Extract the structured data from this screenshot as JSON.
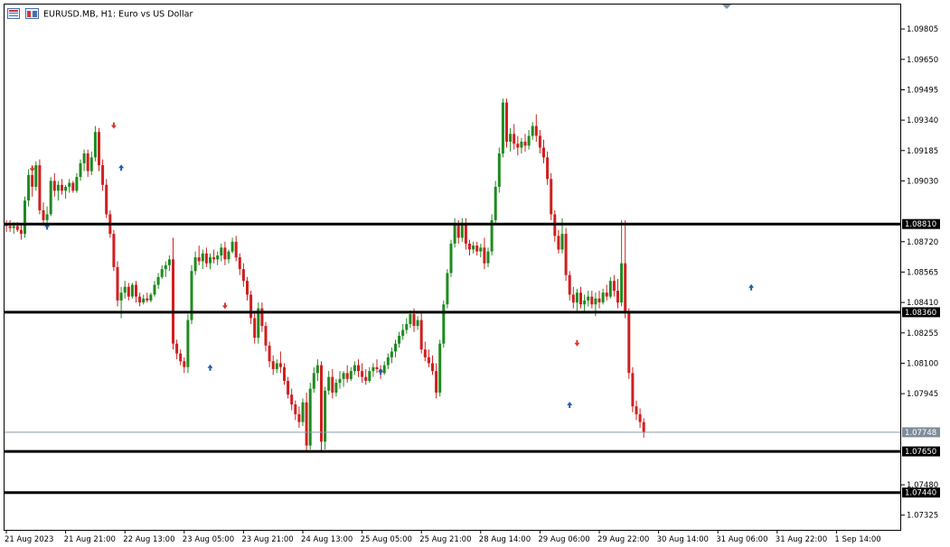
{
  "window": {
    "symbol": "EURUSD.MB",
    "timeframe": "H1",
    "description": "Euro vs US Dollar",
    "title_sep": ", ",
    "desc_sep": ": "
  },
  "colors": {
    "bull": "#1f8a1f",
    "bear": "#d01f1f",
    "doji": "#000000",
    "grid_frame": "#000000",
    "bid_line": "#8a9aa8",
    "bid_label_bg": "#7f8c99",
    "buy_arrow": "#1e5fb4",
    "sell_arrow": "#d9352b"
  },
  "chart_data": {
    "type": "candlestick",
    "ylim": [
      1.0725,
      1.0993
    ],
    "y_ticks": [
      "1.09805",
      "1.09650",
      "1.09495",
      "1.09340",
      "1.09185",
      "1.09030",
      "1.08720",
      "1.08565",
      "1.08410",
      "1.08255",
      "1.08100",
      "1.07945",
      "1.07480",
      "1.07325"
    ],
    "x_ticks": [
      "21 Aug 2023",
      "21 Aug 21:00",
      "22 Aug 13:00",
      "23 Aug 05:00",
      "23 Aug 21:00",
      "24 Aug 13:00",
      "25 Aug 05:00",
      "25 Aug 21:00",
      "28 Aug 14:00",
      "29 Aug 06:00",
      "29 Aug 22:00",
      "30 Aug 14:00",
      "31 Aug 06:00",
      "31 Aug 22:00",
      "1 Sep 14:00"
    ],
    "x_tick_bar_index": [
      0,
      16,
      32,
      48,
      64,
      80,
      96,
      112,
      128,
      144,
      160,
      176,
      192,
      208,
      224
    ],
    "bid": "1.07748",
    "horizontal_lines": [
      "1.08810",
      "1.08360",
      "1.07650",
      "1.07440"
    ],
    "ohlc": [
      [
        1.0881,
        1.0883,
        1.0877,
        1.088
      ],
      [
        1.088,
        1.0883,
        1.0877,
        1.0879
      ],
      [
        1.0879,
        1.0882,
        1.0876,
        1.088
      ],
      [
        1.088,
        1.0882,
        1.0877,
        1.0878
      ],
      [
        1.0878,
        1.0881,
        1.0873,
        1.0876
      ],
      [
        1.0876,
        1.0895,
        1.0874,
        1.0893
      ],
      [
        1.0893,
        1.0909,
        1.089,
        1.0906
      ],
      [
        1.0906,
        1.0908,
        1.0895,
        1.09
      ],
      [
        1.09,
        1.0913,
        1.0898,
        1.0911
      ],
      [
        1.0911,
        1.0914,
        1.0886,
        1.0888
      ],
      [
        1.0888,
        1.0892,
        1.088,
        1.0883
      ],
      [
        1.0883,
        1.089,
        1.088,
        1.0886
      ],
      [
        1.0886,
        1.0905,
        1.0885,
        1.0903
      ],
      [
        1.0903,
        1.0907,
        1.0895,
        1.0898
      ],
      [
        1.0898,
        1.0903,
        1.0893,
        1.0901
      ],
      [
        1.0901,
        1.0904,
        1.0896,
        1.0898
      ],
      [
        1.0898,
        1.0901,
        1.0894,
        1.09
      ],
      [
        1.09,
        1.0904,
        1.0897,
        1.0902
      ],
      [
        1.0902,
        1.0903,
        1.0897,
        1.0898
      ],
      [
        1.0898,
        1.0907,
        1.0897,
        1.0905
      ],
      [
        1.0905,
        1.0914,
        1.0903,
        1.0912
      ],
      [
        1.0912,
        1.0919,
        1.0908,
        1.0917
      ],
      [
        1.0917,
        1.0919,
        1.0905,
        1.0908
      ],
      [
        1.0908,
        1.0918,
        1.0906,
        1.0915
      ],
      [
        1.0915,
        1.0931,
        1.0913,
        1.0928
      ],
      [
        1.0928,
        1.093,
        1.0908,
        1.0911
      ],
      [
        1.0911,
        1.0914,
        1.0898,
        1.0901
      ],
      [
        1.0901,
        1.0904,
        1.0884,
        1.0886
      ],
      [
        1.0886,
        1.0888,
        1.0874,
        1.0876
      ],
      [
        1.0876,
        1.0878,
        1.0857,
        1.0859
      ],
      [
        1.0859,
        1.0862,
        1.0839,
        1.0842
      ],
      [
        1.0842,
        1.0849,
        1.0833,
        1.0846
      ],
      [
        1.0846,
        1.0852,
        1.0843,
        1.0849
      ],
      [
        1.0849,
        1.0851,
        1.0842,
        1.0844
      ],
      [
        1.0844,
        1.0851,
        1.0843,
        1.085
      ],
      [
        1.085,
        1.0852,
        1.0841,
        1.0844
      ],
      [
        1.0844,
        1.0846,
        1.0839,
        1.0841
      ],
      [
        1.0841,
        1.0845,
        1.084,
        1.0843
      ],
      [
        1.0843,
        1.0846,
        1.0841,
        1.0842
      ],
      [
        1.0842,
        1.0846,
        1.0841,
        1.0845
      ],
      [
        1.0845,
        1.0852,
        1.0844,
        1.085
      ],
      [
        1.085,
        1.0856,
        1.0848,
        1.0854
      ],
      [
        1.0854,
        1.086,
        1.0853,
        1.0858
      ],
      [
        1.0858,
        1.0862,
        1.0854,
        1.086
      ],
      [
        1.086,
        1.0865,
        1.0857,
        1.0863
      ],
      [
        1.0863,
        1.0874,
        1.0817,
        1.082
      ],
      [
        1.082,
        1.0822,
        1.0812,
        1.0815
      ],
      [
        1.0815,
        1.0817,
        1.0809,
        1.0811
      ],
      [
        1.0811,
        1.0813,
        1.0805,
        1.0808
      ],
      [
        1.0808,
        1.0835,
        1.0805,
        1.0832
      ],
      [
        1.0832,
        1.086,
        1.083,
        1.0857
      ],
      [
        1.0857,
        1.0867,
        1.0855,
        1.0864
      ],
      [
        1.0864,
        1.087,
        1.086,
        1.0862
      ],
      [
        1.0862,
        1.0868,
        1.0858,
        1.0866
      ],
      [
        1.0866,
        1.0869,
        1.0859,
        1.0861
      ],
      [
        1.0861,
        1.0866,
        1.0858,
        1.0864
      ],
      [
        1.0864,
        1.0868,
        1.0861,
        1.0863
      ],
      [
        1.0863,
        1.0867,
        1.086,
        1.0865
      ],
      [
        1.0865,
        1.0871,
        1.0862,
        1.0869
      ],
      [
        1.0869,
        1.0872,
        1.086,
        1.0863
      ],
      [
        1.0863,
        1.0868,
        1.0861,
        1.0867
      ],
      [
        1.0867,
        1.0874,
        1.0866,
        1.0872
      ],
      [
        1.0872,
        1.0875,
        1.0862,
        1.0864
      ],
      [
        1.0864,
        1.0866,
        1.0855,
        1.0858
      ],
      [
        1.0858,
        1.0861,
        1.0849,
        1.0852
      ],
      [
        1.0852,
        1.0854,
        1.0842,
        1.0845
      ],
      [
        1.0845,
        1.0847,
        1.083,
        1.0833
      ],
      [
        1.0833,
        1.0836,
        1.082,
        1.0823
      ],
      [
        1.0823,
        1.0841,
        1.082,
        1.0838
      ],
      [
        1.0838,
        1.0841,
        1.0826,
        1.0829
      ],
      [
        1.0829,
        1.0831,
        1.0816,
        1.0819
      ],
      [
        1.0819,
        1.0821,
        1.0808,
        1.0811
      ],
      [
        1.0811,
        1.0814,
        1.0804,
        1.0807
      ],
      [
        1.0807,
        1.0812,
        1.0805,
        1.081
      ],
      [
        1.081,
        1.0816,
        1.0805,
        1.0808
      ],
      [
        1.0808,
        1.081,
        1.0799,
        1.0801
      ],
      [
        1.0801,
        1.0803,
        1.0792,
        1.0794
      ],
      [
        1.0794,
        1.0797,
        1.0786,
        1.0789
      ],
      [
        1.0789,
        1.0791,
        1.0781,
        1.0784
      ],
      [
        1.0784,
        1.0788,
        1.0777,
        1.078
      ],
      [
        1.078,
        1.0792,
        1.0778,
        1.079
      ],
      [
        1.079,
        1.0795,
        1.0765,
        1.0768
      ],
      [
        1.0768,
        1.08,
        1.0766,
        1.0797
      ],
      [
        1.0797,
        1.0808,
        1.0795,
        1.0805
      ],
      [
        1.0805,
        1.0812,
        1.0801,
        1.0809
      ],
      [
        1.0809,
        1.0811,
        1.0765,
        1.077
      ],
      [
        1.077,
        1.0798,
        1.0766,
        1.0796
      ],
      [
        1.0796,
        1.0806,
        1.0794,
        1.0803
      ],
      [
        1.0803,
        1.0807,
        1.0792,
        1.0795
      ],
      [
        1.0795,
        1.0802,
        1.0793,
        1.08
      ],
      [
        1.08,
        1.0806,
        1.0797,
        1.0802
      ],
      [
        1.0802,
        1.0806,
        1.0798,
        1.0805
      ],
      [
        1.0805,
        1.0809,
        1.08,
        1.0802
      ],
      [
        1.0802,
        1.0808,
        1.0801,
        1.0806
      ],
      [
        1.0806,
        1.0811,
        1.0804,
        1.0809
      ],
      [
        1.0809,
        1.0812,
        1.0803,
        1.0806
      ],
      [
        1.0806,
        1.081,
        1.08,
        1.0803
      ],
      [
        1.0803,
        1.0807,
        1.0799,
        1.0801
      ],
      [
        1.0801,
        1.0808,
        1.08,
        1.0806
      ],
      [
        1.0806,
        1.081,
        1.0803,
        1.0808
      ],
      [
        1.0808,
        1.0812,
        1.0805,
        1.0807
      ],
      [
        1.0807,
        1.0809,
        1.0802,
        1.0805
      ],
      [
        1.0805,
        1.0811,
        1.0804,
        1.0809
      ],
      [
        1.0809,
        1.0815,
        1.0807,
        1.0813
      ],
      [
        1.0813,
        1.0818,
        1.081,
        1.0816
      ],
      [
        1.0816,
        1.0822,
        1.0813,
        1.082
      ],
      [
        1.082,
        1.0826,
        1.0818,
        1.0824
      ],
      [
        1.0824,
        1.083,
        1.0822,
        1.0827
      ],
      [
        1.0827,
        1.0833,
        1.0825,
        1.083
      ],
      [
        1.083,
        1.0837,
        1.0828,
        1.0835
      ],
      [
        1.0835,
        1.0838,
        1.0826,
        1.0829
      ],
      [
        1.0829,
        1.0834,
        1.0827,
        1.0832
      ],
      [
        1.0832,
        1.0836,
        1.0815,
        1.0817
      ],
      [
        1.0817,
        1.0821,
        1.0811,
        1.0813
      ],
      [
        1.0813,
        1.0817,
        1.0808,
        1.081
      ],
      [
        1.081,
        1.0814,
        1.0804,
        1.0806
      ],
      [
        1.0806,
        1.081,
        1.0792,
        1.0795
      ],
      [
        1.0795,
        1.0822,
        1.0793,
        1.082
      ],
      [
        1.082,
        1.0842,
        1.0818,
        1.084
      ],
      [
        1.084,
        1.0858,
        1.0838,
        1.0856
      ],
      [
        1.0856,
        1.0873,
        1.0854,
        1.0871
      ],
      [
        1.0871,
        1.0884,
        1.0869,
        1.0881
      ],
      [
        1.0881,
        1.0883,
        1.0871,
        1.0874
      ],
      [
        1.0874,
        1.0884,
        1.0872,
        1.0881
      ],
      [
        1.0881,
        1.0884,
        1.0868,
        1.0871
      ],
      [
        1.0871,
        1.0873,
        1.0865,
        1.0868
      ],
      [
        1.0868,
        1.0872,
        1.0866,
        1.087
      ],
      [
        1.087,
        1.0872,
        1.0865,
        1.0867
      ],
      [
        1.0867,
        1.0871,
        1.0864,
        1.0869
      ],
      [
        1.0869,
        1.0874,
        1.0858,
        1.0861
      ],
      [
        1.0861,
        1.0869,
        1.0859,
        1.0867
      ],
      [
        1.0867,
        1.0886,
        1.0865,
        1.0883
      ],
      [
        1.0883,
        1.0903,
        1.0881,
        1.09
      ],
      [
        1.09,
        1.092,
        1.0897,
        1.0917
      ],
      [
        1.0917,
        1.0945,
        1.0915,
        1.0943
      ],
      [
        1.0943,
        1.0945,
        1.092,
        1.0923
      ],
      [
        1.0923,
        1.093,
        1.0918,
        1.0927
      ],
      [
        1.0927,
        1.0932,
        1.0919,
        1.0922
      ],
      [
        1.0922,
        1.0926,
        1.0916,
        1.092
      ],
      [
        1.092,
        1.0925,
        1.0917,
        1.0923
      ],
      [
        1.0923,
        1.0927,
        1.0918,
        1.0921
      ],
      [
        1.0921,
        1.0929,
        1.0919,
        1.0926
      ],
      [
        1.0926,
        1.0933,
        1.0924,
        1.0931
      ],
      [
        1.0931,
        1.0937,
        1.0923,
        1.0926
      ],
      [
        1.0926,
        1.0929,
        1.0917,
        1.092
      ],
      [
        1.092,
        1.0924,
        1.0912,
        1.0915
      ],
      [
        1.0915,
        1.0918,
        1.0901,
        1.0904
      ],
      [
        1.0904,
        1.0907,
        1.0883,
        1.0886
      ],
      [
        1.0886,
        1.0888,
        1.0872,
        1.0875
      ],
      [
        1.0875,
        1.0878,
        1.0866,
        1.0868
      ],
      [
        1.0868,
        1.0884,
        1.0866,
        1.0876
      ],
      [
        1.0876,
        1.0879,
        1.0852,
        1.0855
      ],
      [
        1.0855,
        1.0857,
        1.0842,
        1.0845
      ],
      [
        1.0845,
        1.0849,
        1.0838,
        1.0841
      ],
      [
        1.0841,
        1.0848,
        1.0836,
        1.0846
      ],
      [
        1.0846,
        1.0849,
        1.0838,
        1.084
      ],
      [
        1.084,
        1.0845,
        1.0836,
        1.0842
      ],
      [
        1.0842,
        1.0847,
        1.0839,
        1.0844
      ],
      [
        1.0844,
        1.0847,
        1.0838,
        1.084
      ],
      [
        1.084,
        1.0846,
        1.0834,
        1.0843
      ],
      [
        1.0843,
        1.0847,
        1.0838,
        1.0841
      ],
      [
        1.0841,
        1.0848,
        1.084,
        1.0846
      ],
      [
        1.0846,
        1.085,
        1.0842,
        1.0844
      ],
      [
        1.0844,
        1.0854,
        1.0843,
        1.0852
      ],
      [
        1.0852,
        1.0855,
        1.0844,
        1.0847
      ],
      [
        1.0847,
        1.0853,
        1.0838,
        1.0841
      ],
      [
        1.0841,
        1.0883,
        1.0839,
        1.0861
      ],
      [
        1.0861,
        1.0883,
        1.0833,
        1.0836
      ],
      [
        1.0836,
        1.0838,
        1.0802,
        1.0805
      ],
      [
        1.0805,
        1.0808,
        1.0785,
        1.0788
      ],
      [
        1.0788,
        1.0791,
        1.0781,
        1.0784
      ],
      [
        1.0784,
        1.0787,
        1.0777,
        1.078
      ],
      [
        1.078,
        1.0782,
        1.0772,
        1.0775
      ]
    ],
    "markers": [
      {
        "bar": 7,
        "type": "sell",
        "price": 1.0909
      },
      {
        "bar": 11,
        "type": "buy",
        "price": 1.088
      },
      {
        "bar": 29,
        "type": "sell",
        "price": 1.0931
      },
      {
        "bar": 31,
        "type": "buy",
        "price": 1.091
      },
      {
        "bar": 55,
        "type": "buy",
        "price": 1.0808
      },
      {
        "bar": 59,
        "type": "sell",
        "price": 1.0839
      },
      {
        "bar": 101,
        "type": "buy",
        "price": 1.0806
      },
      {
        "bar": 152,
        "type": "buy",
        "price": 1.0789
      },
      {
        "bar": 154,
        "type": "sell",
        "price": 1.082
      },
      {
        "bar": 201,
        "type": "buy",
        "price": 1.0849
      }
    ]
  }
}
